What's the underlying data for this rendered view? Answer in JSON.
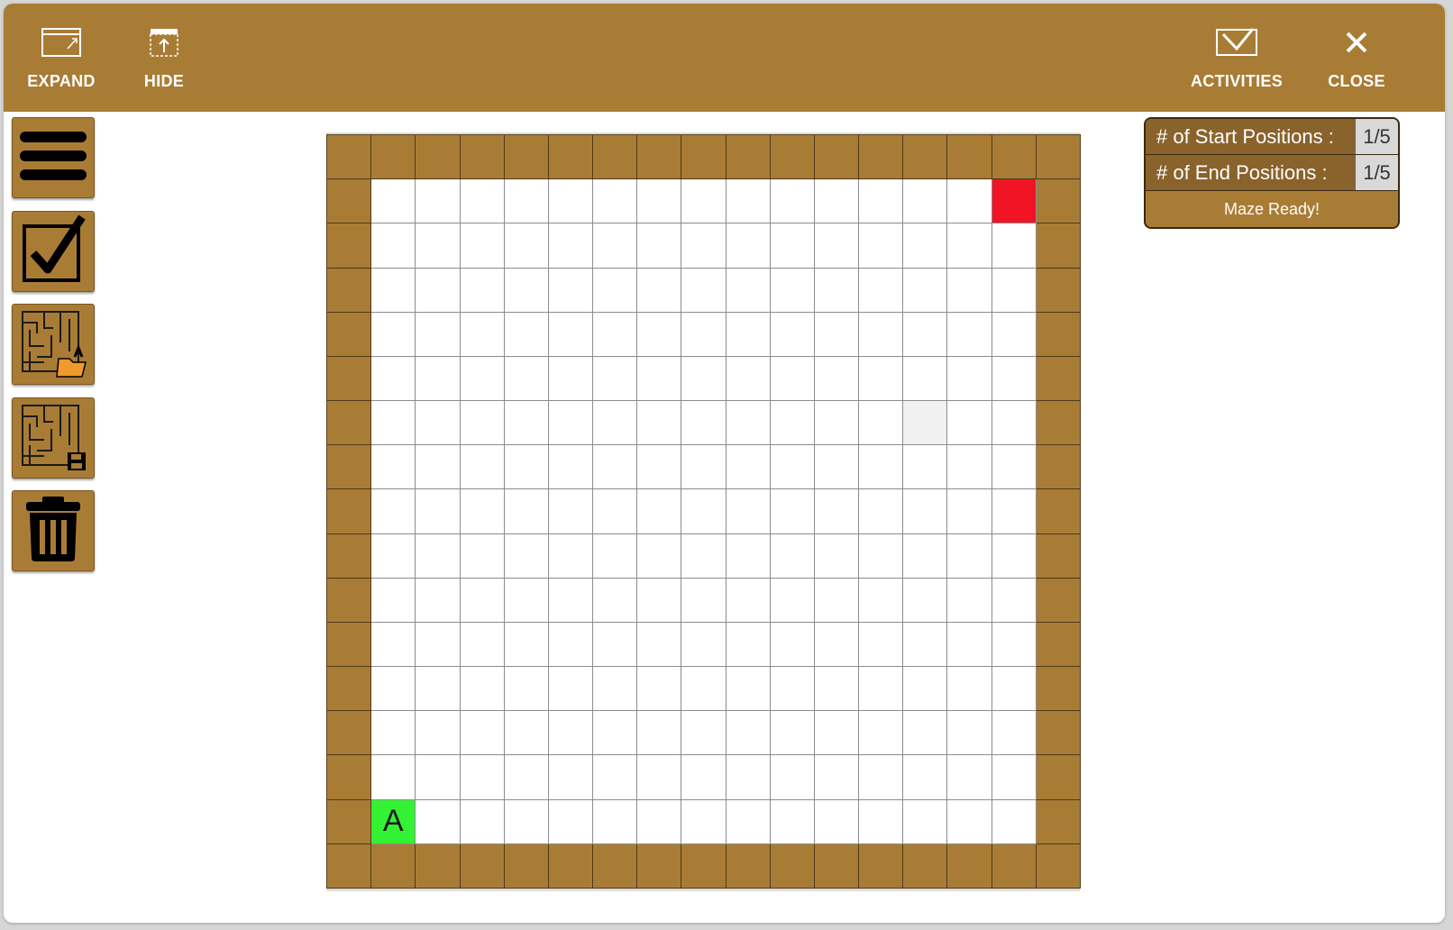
{
  "topbar": {
    "expand_label": "EXPAND",
    "hide_label": "HIDE",
    "activities_label": "ACTIVITIES",
    "close_label": "CLOSE"
  },
  "sidebar": {
    "items": [
      {
        "name": "menu",
        "icon": "hamburger-menu-icon"
      },
      {
        "name": "check",
        "icon": "checkbox-check-icon"
      },
      {
        "name": "load-maze",
        "icon": "maze-open-folder-icon"
      },
      {
        "name": "save-maze",
        "icon": "maze-save-disk-icon"
      },
      {
        "name": "delete",
        "icon": "trash-icon"
      }
    ]
  },
  "maze": {
    "rows": 17,
    "cols": 17,
    "start": {
      "row": 15,
      "col": 1,
      "label": "A"
    },
    "end": {
      "row": 1,
      "col": 15
    },
    "highlight": {
      "row": 6,
      "col": 13
    }
  },
  "panel": {
    "start_positions_label": "# of Start Positions :",
    "start_positions_value": "1/5",
    "end_positions_label": "# of End Positions :",
    "end_positions_value": "1/5",
    "status": "Maze Ready!"
  },
  "colors": {
    "brand": "#a97c35",
    "wall": "#a97c35",
    "start": "#33f233",
    "end": "#f01424",
    "panel_label_bg": "#8a622c"
  }
}
